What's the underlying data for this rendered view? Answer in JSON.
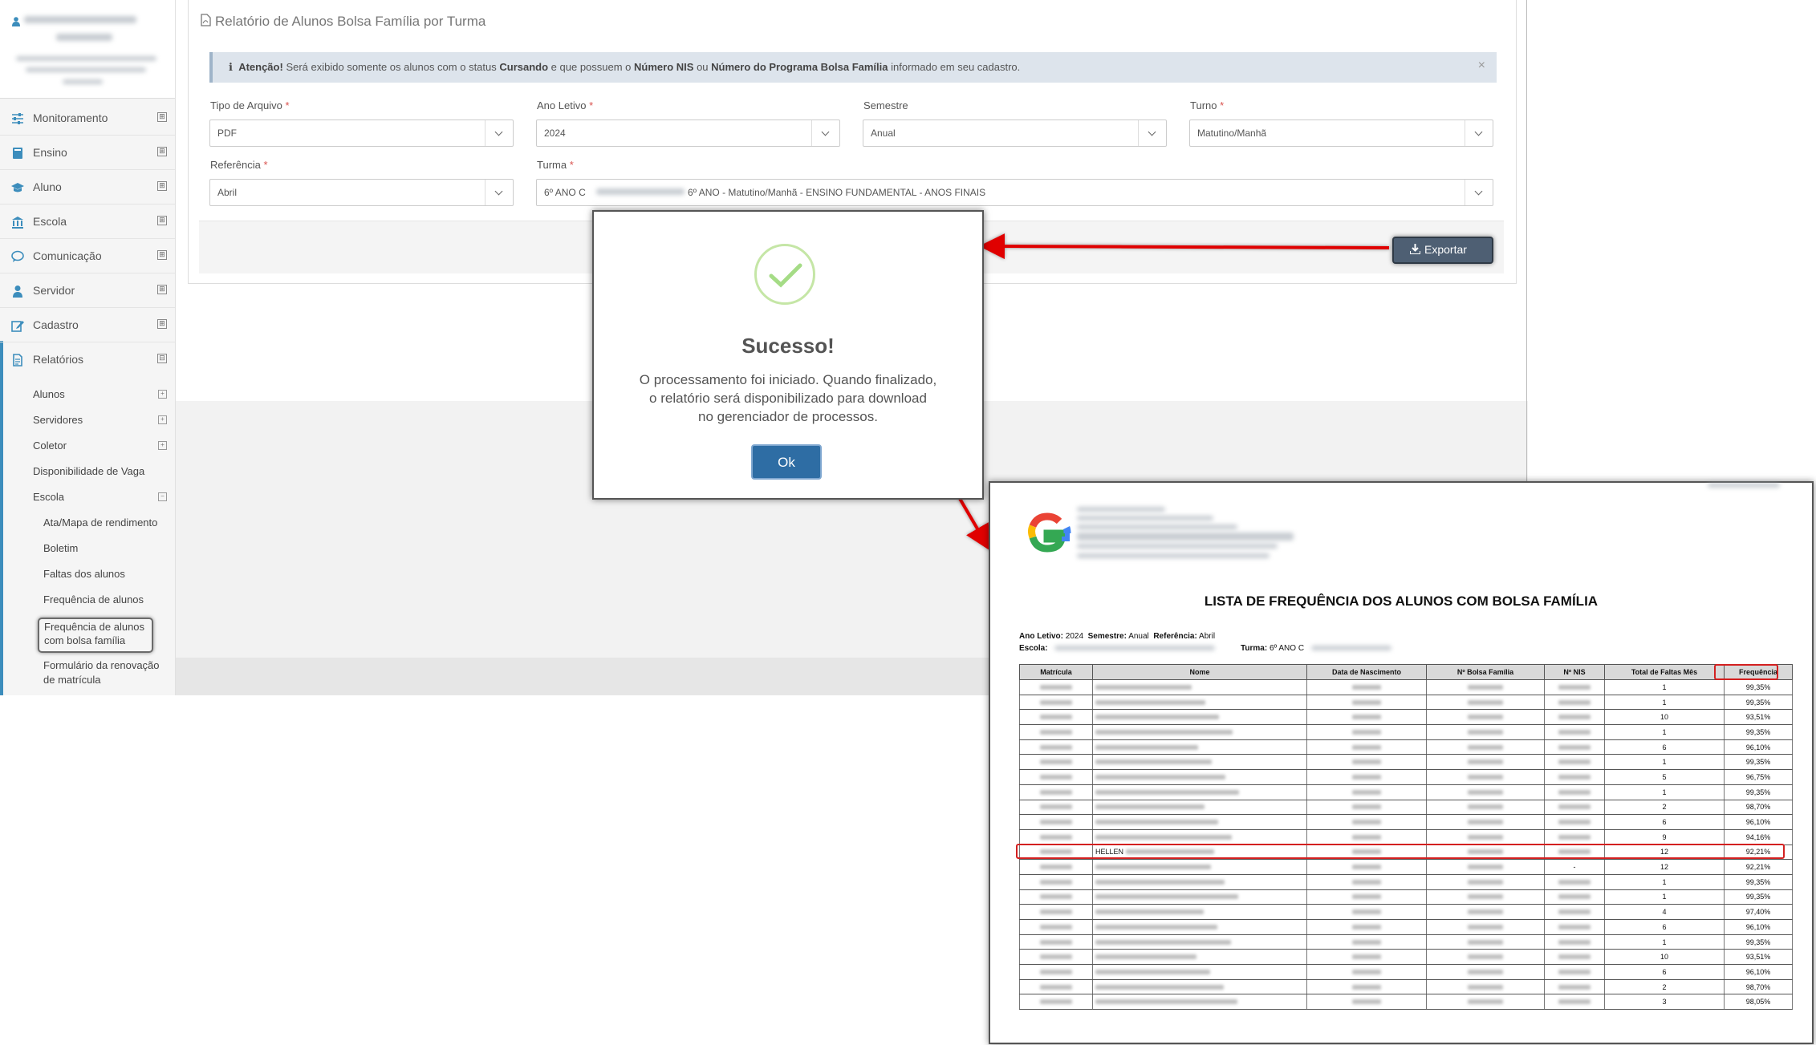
{
  "sidebar": {
    "menu": [
      {
        "label": "Monitoramento",
        "toggle": "⊞"
      },
      {
        "label": "Ensino",
        "toggle": "⊞"
      },
      {
        "label": "Aluno",
        "toggle": "⊞"
      },
      {
        "label": "Escola",
        "toggle": "⊞"
      },
      {
        "label": "Comunicação",
        "toggle": "⊞"
      },
      {
        "label": "Servidor",
        "toggle": "⊞"
      },
      {
        "label": "Cadastro",
        "toggle": "⊞"
      },
      {
        "label": "Relatórios",
        "toggle": "⊟"
      }
    ],
    "sub": {
      "alunos": "Alunos",
      "servidores": "Servidores",
      "coletor": "Coletor",
      "disponibilidade": "Disponibilidade de Vaga",
      "escola": "Escola",
      "ata": "Ata/Mapa de rendimento",
      "boletim": "Boletim",
      "faltas": "Faltas dos alunos",
      "frequencia": "Frequência de alunos",
      "freq_bolsa_1": "Frequência de alunos",
      "freq_bolsa_2": "com bolsa família",
      "formulario_1": "Formulário da renovação",
      "formulario_2": "de matrícula"
    }
  },
  "page": {
    "title": "Relatório de Alunos Bolsa Família por Turma",
    "alert": {
      "icon": "ℹ",
      "strong": "Atenção!",
      "t1": "Será exibido somente os alunos com o status",
      "b1": "Cursando",
      "t2": "e que possuem o",
      "b2": "Número NIS",
      "t3": "ou",
      "b3": "Número do Programa Bolsa Família",
      "t4": "informado em seu cadastro.",
      "close": "×"
    },
    "form": {
      "tipo_label": "Tipo de Arquivo",
      "tipo_value": "PDF",
      "ano_label": "Ano Letivo",
      "ano_value": "2024",
      "semestre_label": "Semestre",
      "semestre_value": "Anual",
      "turno_label": "Turno",
      "turno_value": "Matutino/Manhã",
      "referencia_label": "Referência",
      "referencia_value": "Abril",
      "turma_label": "Turma",
      "turma_value_a": "6º ANO C",
      "turma_value_b": "6º ANO - Matutino/Manhã - ENSINO FUNDAMENTAL - ANOS FINAIS",
      "required_mark": "*"
    },
    "export_label": "Exportar"
  },
  "modal": {
    "title": "Sucesso!",
    "line1": "O processamento foi iniciado. Quando finalizado,",
    "line2": "o relatório será disponibilizado para download",
    "line3": "no gerenciador de processos.",
    "ok_label": "Ok"
  },
  "report": {
    "title": "LISTA DE FREQUÊNCIA DOS ALUNOS COM BOLSA FAMÍLIA",
    "meta_ano_label": "Ano Letivo:",
    "meta_ano": "2024",
    "meta_sem_label": "Semestre:",
    "meta_sem": "Anual",
    "meta_ref_label": "Referência:",
    "meta_ref": "Abril",
    "meta_escola_label": "Escola:",
    "meta_turma_label": "Turma:",
    "meta_turma": "6º ANO C",
    "columns": [
      "Matrícula",
      "Nome",
      "Data de Nascimento",
      "Nº Bolsa Família",
      "Nº NIS",
      "Total de Faltas Mês",
      "Frequência"
    ],
    "rows": [
      {
        "nome": "",
        "nis": "",
        "faltas": "1",
        "freq": "99,35%"
      },
      {
        "nome": "",
        "nis": "",
        "faltas": "1",
        "freq": "99,35%"
      },
      {
        "nome": "",
        "nis": "",
        "faltas": "10",
        "freq": "93,51%"
      },
      {
        "nome": "",
        "nis": "",
        "faltas": "1",
        "freq": "99,35%"
      },
      {
        "nome": "",
        "nis": "",
        "faltas": "6",
        "freq": "96,10%"
      },
      {
        "nome": "",
        "nis": "",
        "faltas": "1",
        "freq": "99,35%"
      },
      {
        "nome": "",
        "nis": "",
        "faltas": "5",
        "freq": "96,75%"
      },
      {
        "nome": "",
        "nis": "",
        "faltas": "1",
        "freq": "99,35%"
      },
      {
        "nome": "",
        "nis": "",
        "faltas": "2",
        "freq": "98,70%"
      },
      {
        "nome": "",
        "nis": "",
        "faltas": "6",
        "freq": "96,10%"
      },
      {
        "nome": "",
        "nis": "",
        "faltas": "9",
        "freq": "94,16%"
      },
      {
        "nome": "HELLEN",
        "nis": "",
        "faltas": "12",
        "freq": "92,21%"
      },
      {
        "nome": "",
        "nis": "-",
        "faltas": "12",
        "freq": "92,21%"
      },
      {
        "nome": "",
        "nis": "",
        "faltas": "1",
        "freq": "99,35%"
      },
      {
        "nome": "",
        "nis": "",
        "faltas": "1",
        "freq": "99,35%"
      },
      {
        "nome": "",
        "nis": "",
        "faltas": "4",
        "freq": "97,40%"
      },
      {
        "nome": "",
        "nis": "",
        "faltas": "6",
        "freq": "96,10%"
      },
      {
        "nome": "",
        "nis": "",
        "faltas": "1",
        "freq": "99,35%"
      },
      {
        "nome": "",
        "nis": "",
        "faltas": "10",
        "freq": "93,51%"
      },
      {
        "nome": "",
        "nis": "",
        "faltas": "6",
        "freq": "96,10%"
      },
      {
        "nome": "",
        "nis": "",
        "faltas": "2",
        "freq": "98,70%"
      },
      {
        "nome": "",
        "nis": "",
        "faltas": "3",
        "freq": "98,05%"
      }
    ]
  },
  "colors": {
    "accent": "#3c8dbc",
    "export_button": "#4e5f73",
    "ok_button": "#2e6da4",
    "highlight": "#d32020",
    "success_check": "#a5dc86"
  }
}
